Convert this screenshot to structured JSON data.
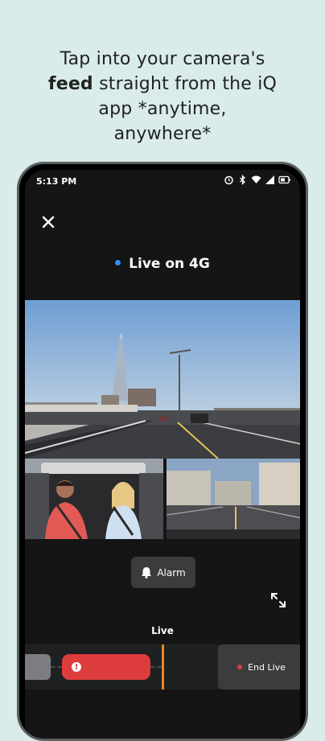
{
  "headline": {
    "line1": "Tap into your camera's",
    "bold": "feed",
    "line2_rest": " straight from the iQ",
    "line3": "app *anytime,",
    "line4": "anywhere*"
  },
  "status_bar": {
    "time": "5:13 PM",
    "icons": [
      "alarm-icon",
      "bluetooth-icon",
      "wifi-icon",
      "signal-icon",
      "battery-icon"
    ]
  },
  "header": {
    "close_icon": "close-icon",
    "live_title": "Live on 4G",
    "live_dot_color": "#2e8ff5"
  },
  "feeds": {
    "main": "front-road-camera-feed",
    "cabin": "cabin-camera-feed",
    "rear": "rear-camera-feed"
  },
  "controls": {
    "alarm_label": "Alarm",
    "alarm_icon": "bell-icon",
    "expand_icon": "expand-icon"
  },
  "timeline": {
    "label": "Live",
    "end_live_label": "End Live",
    "event_color": "#dd3c3d",
    "cursor_color": "#e58a1e"
  }
}
